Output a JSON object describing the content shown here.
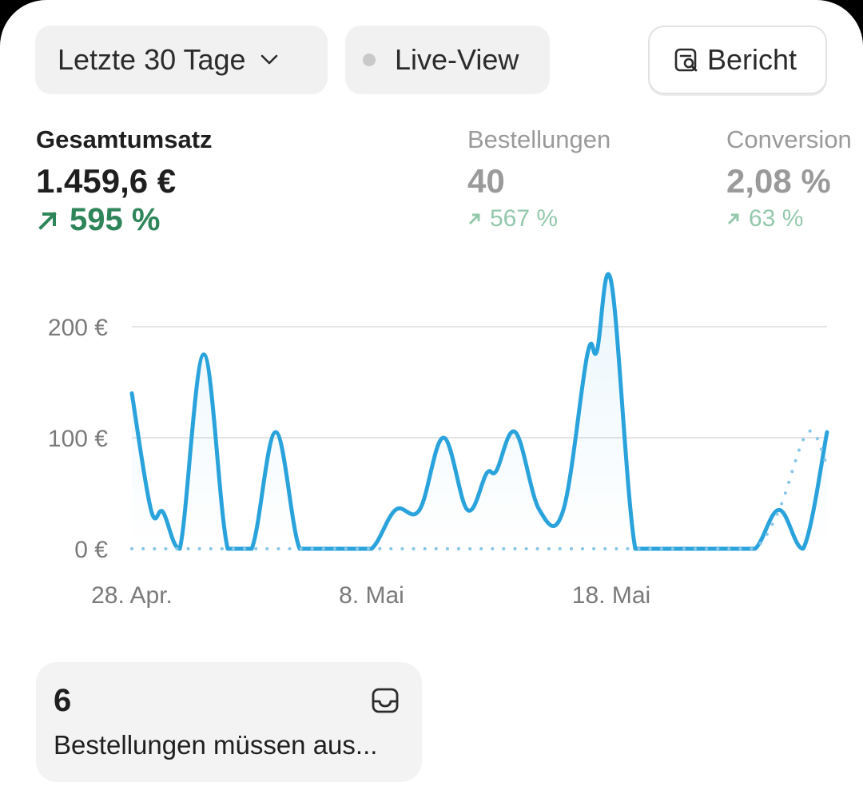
{
  "toolbar": {
    "range_label": "Letzte 30 Tage",
    "live_label": "Live-View",
    "report_label": "Bericht"
  },
  "metrics": [
    {
      "label": "Gesamtumsatz",
      "value": "1.459,6 €",
      "delta": "595 %"
    },
    {
      "label": "Bestellungen",
      "value": "40",
      "delta": "567 %"
    },
    {
      "label": "Conversion",
      "value": "2,08 %",
      "delta": "63 %"
    }
  ],
  "card": {
    "count": "6",
    "description": "Bestellungen müssen aus..."
  },
  "colors": {
    "accent_line": "#2aa3dc",
    "positive": "#2f855a",
    "positive_muted": "#93c8ac",
    "muted_text": "#9a9a9a"
  },
  "chart_data": {
    "type": "line",
    "xlabel": "",
    "ylabel": "",
    "ylim": [
      0,
      240
    ],
    "yticks": [
      {
        "value": 0,
        "label": "0 €"
      },
      {
        "value": 100,
        "label": "100 €"
      },
      {
        "value": 200,
        "label": "200 €"
      }
    ],
    "xticks": [
      {
        "day": 0,
        "label": "28. Apr."
      },
      {
        "day": 10,
        "label": "8. Mai"
      },
      {
        "day": 20,
        "label": "18. Mai"
      }
    ],
    "grid": true,
    "legend": "none",
    "series": [
      {
        "style": "solid",
        "points": [
          [
            0,
            140
          ],
          [
            0.8,
            35
          ],
          [
            1.3,
            33
          ],
          [
            2,
            0
          ],
          [
            3,
            175
          ],
          [
            4,
            0
          ],
          [
            5,
            0
          ],
          [
            6,
            105
          ],
          [
            7,
            0
          ],
          [
            8,
            0
          ],
          [
            9,
            0
          ],
          [
            10,
            0
          ],
          [
            11,
            35
          ],
          [
            12,
            35
          ],
          [
            13,
            100
          ],
          [
            14,
            35
          ],
          [
            14.8,
            68
          ],
          [
            15.2,
            70
          ],
          [
            16,
            105
          ],
          [
            17,
            35
          ],
          [
            18,
            35
          ],
          [
            19,
            175
          ],
          [
            19.4,
            178
          ],
          [
            20,
            240
          ],
          [
            21,
            0
          ],
          [
            22,
            0
          ],
          [
            23,
            0
          ],
          [
            24,
            0
          ],
          [
            25,
            0
          ],
          [
            26,
            0
          ],
          [
            27,
            35
          ],
          [
            28,
            0
          ],
          [
            29,
            105
          ]
        ]
      },
      {
        "style": "dotted",
        "points": [
          [
            0,
            0
          ],
          [
            1,
            0
          ],
          [
            2,
            0
          ],
          [
            3,
            0
          ],
          [
            4,
            0
          ],
          [
            5,
            0
          ],
          [
            6,
            0
          ],
          [
            7,
            0
          ],
          [
            8,
            0
          ],
          [
            9,
            0
          ],
          [
            10,
            0
          ],
          [
            11,
            0
          ],
          [
            12,
            0
          ],
          [
            13,
            0
          ],
          [
            14,
            0
          ],
          [
            15,
            0
          ],
          [
            16,
            0
          ],
          [
            17,
            0
          ],
          [
            18,
            0
          ],
          [
            19,
            0
          ],
          [
            20,
            0
          ],
          [
            21,
            0
          ],
          [
            22,
            0
          ],
          [
            23,
            0
          ],
          [
            24,
            0
          ],
          [
            25,
            0
          ],
          [
            26,
            0
          ],
          [
            27,
            35
          ],
          [
            28.2,
            105
          ],
          [
            29,
            75
          ]
        ]
      }
    ]
  }
}
